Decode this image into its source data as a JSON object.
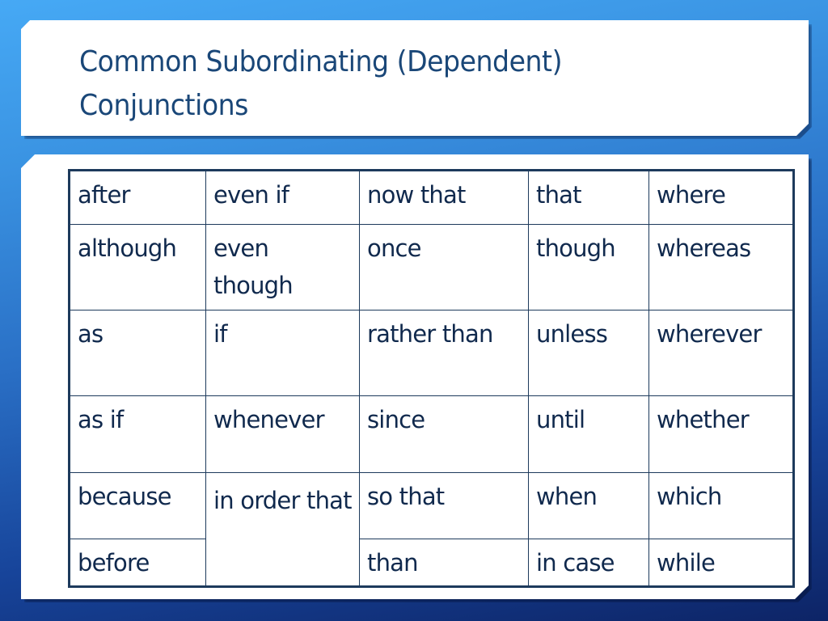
{
  "slide": {
    "title_line1": "Common Subordinating (Dependent)",
    "title_line2": "Conjunctions",
    "colors": {
      "title_text": "#1a4778",
      "table_text": "#10294d",
      "table_border": "#1d3a5c",
      "background_top": "#46a9f5",
      "background_bottom": "#0d2466"
    }
  },
  "table": {
    "rows": [
      [
        "after",
        "even if",
        "now that",
        "that",
        "where"
      ],
      [
        "althoug h",
        "even though",
        "once",
        "though",
        "whereas"
      ],
      [
        "as",
        "if",
        "rather than",
        "unless",
        "wherever"
      ],
      [
        "as if",
        "whenever",
        "since",
        "until",
        "whether"
      ],
      [
        "because",
        "in order that",
        "so that",
        "when",
        "which"
      ],
      [
        "before",
        null,
        "than",
        "in case",
        "while"
      ]
    ],
    "cells": {
      "r1c1": "after",
      "r1c2": "even if",
      "r1c3": "now that",
      "r1c4": "that",
      "r1c5": "where",
      "r2c1": "although",
      "r2c2": "even though",
      "r2c3": "once",
      "r2c4": "though",
      "r2c5": "whereas",
      "r3c1": "as",
      "r3c2": "if",
      "r3c3": "rather than",
      "r3c4": "unless",
      "r3c5": "wherever",
      "r4c1": "as if",
      "r4c2": "whenever",
      "r4c3": "since",
      "r4c4": "until",
      "r4c5": "whether",
      "r5c1": "because",
      "r5c2": "in order that",
      "r5c3": "so that",
      "r5c4": "when",
      "r5c5": "which",
      "r6c1": "before",
      "r6c3": "than",
      "r6c4": "in case",
      "r6c5": "while"
    }
  }
}
